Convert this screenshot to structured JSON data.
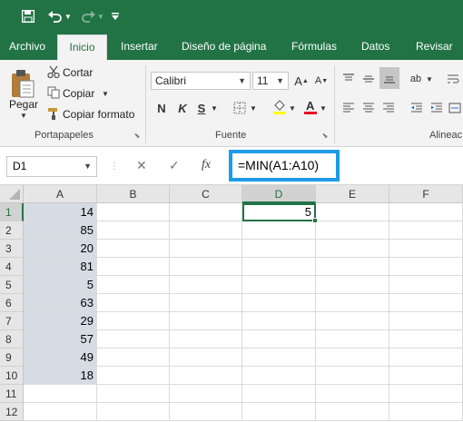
{
  "quick_access": {
    "save_icon": "save-icon",
    "undo_icon": "undo-icon",
    "redo_icon": "redo-icon",
    "customize_icon": "customize-icon"
  },
  "tabs": [
    "Archivo",
    "Inicio",
    "Insertar",
    "Diseño de página",
    "Fórmulas",
    "Datos",
    "Revisar"
  ],
  "ribbon": {
    "clipboard": {
      "paste_label": "Pegar",
      "cut_label": "Cortar",
      "copy_label": "Copiar",
      "format_painter_label": "Copiar formato",
      "group_label": "Portapapeles"
    },
    "font": {
      "name": "Calibri",
      "size": "11",
      "bold": "N",
      "italic": "K",
      "underline": "S",
      "group_label": "Fuente"
    },
    "alignment": {
      "group_label": "Alineac"
    }
  },
  "formula_bar": {
    "name_box": "D1",
    "fx_label": "fx",
    "formula": "=MIN(A1:A10)"
  },
  "grid": {
    "columns": [
      "A",
      "B",
      "C",
      "D",
      "E",
      "F"
    ],
    "rows": [
      "1",
      "2",
      "3",
      "4",
      "5",
      "6",
      "7",
      "8",
      "9",
      "10",
      "11",
      "12"
    ],
    "column_a_values": [
      "14",
      "85",
      "20",
      "81",
      "5",
      "63",
      "29",
      "57",
      "49",
      "18"
    ],
    "d1_value": "5",
    "selected_cell": "D1"
  },
  "colors": {
    "excel_green": "#217346",
    "highlight_box": "#1e9be8",
    "shaded_cells": "#d6dce4"
  }
}
